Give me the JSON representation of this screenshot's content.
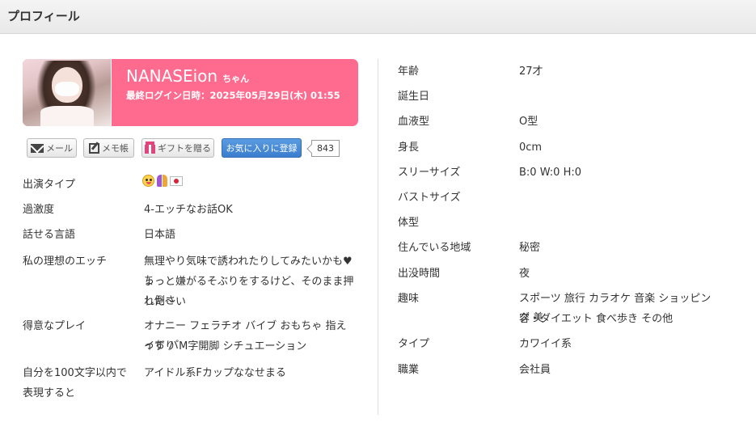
{
  "header": {
    "title": "プロフィール"
  },
  "profile": {
    "name": "NANASEion",
    "suffix": "ちゃん",
    "last_login": "最終ログイン日時：2025年05月29日(木) 01:55"
  },
  "actions": {
    "mail_label": "メール",
    "memo_label": "メモ帳",
    "gift_label": "ギフトを贈る",
    "favorite_label": "お気に入りに登録",
    "favorite_count": "843"
  },
  "left_details": [
    {
      "label": "出演タイプ",
      "value": "",
      "icons": [
        "face-icon",
        "toy-icon",
        "japan-flag-icon"
      ]
    },
    {
      "label": "過激度",
      "value": "4-エッチなお話OK"
    },
    {
      "label": "話せる言語",
      "value": "日本語"
    },
    {
      "label": "私の理想のエッチ",
      "value_lines": [
        "無理やり気味で誘われたりしてみたいかも♥ち",
        "ょっと嫌がるそぶりをするけど、そのまま押し倒さ",
        "れた〜い"
      ]
    },
    {
      "label": "得意なプレイ",
      "value_lines": [
        "オナニー フェラチオ バイブ おもちゃ 指えっち パ",
        "イずり M字開脚 シチュエーション"
      ]
    },
    {
      "label_lines": [
        "自分を100文字以内で",
        "表現すると"
      ],
      "value": "アイドル系Fカップななせまる"
    }
  ],
  "right_details": [
    {
      "label": "年齢",
      "value": "27才"
    },
    {
      "label": "誕生日",
      "value": ""
    },
    {
      "label": "血液型",
      "value": "O型"
    },
    {
      "label": "身長",
      "value": "0cm"
    },
    {
      "label": "スリーサイズ",
      "value": "B:0 W:0 H:0"
    },
    {
      "label": "バストサイズ",
      "value": ""
    },
    {
      "label": "体型",
      "value": ""
    },
    {
      "label": "住んでいる地域",
      "value": "秘密"
    },
    {
      "label": "出没時間",
      "value": "夜"
    },
    {
      "label": "趣味",
      "value_lines": [
        "スポーツ 旅行 カラオケ 音楽 ショッピング 美",
        "容・ダイエット 食べ歩き その他"
      ]
    },
    {
      "label": "タイプ",
      "value": "カワイイ系"
    },
    {
      "label": "職業",
      "value": "会社員"
    }
  ],
  "colors": {
    "accent_pink": "#ff6b8f",
    "favorite_blue": "#3b7ecf"
  }
}
